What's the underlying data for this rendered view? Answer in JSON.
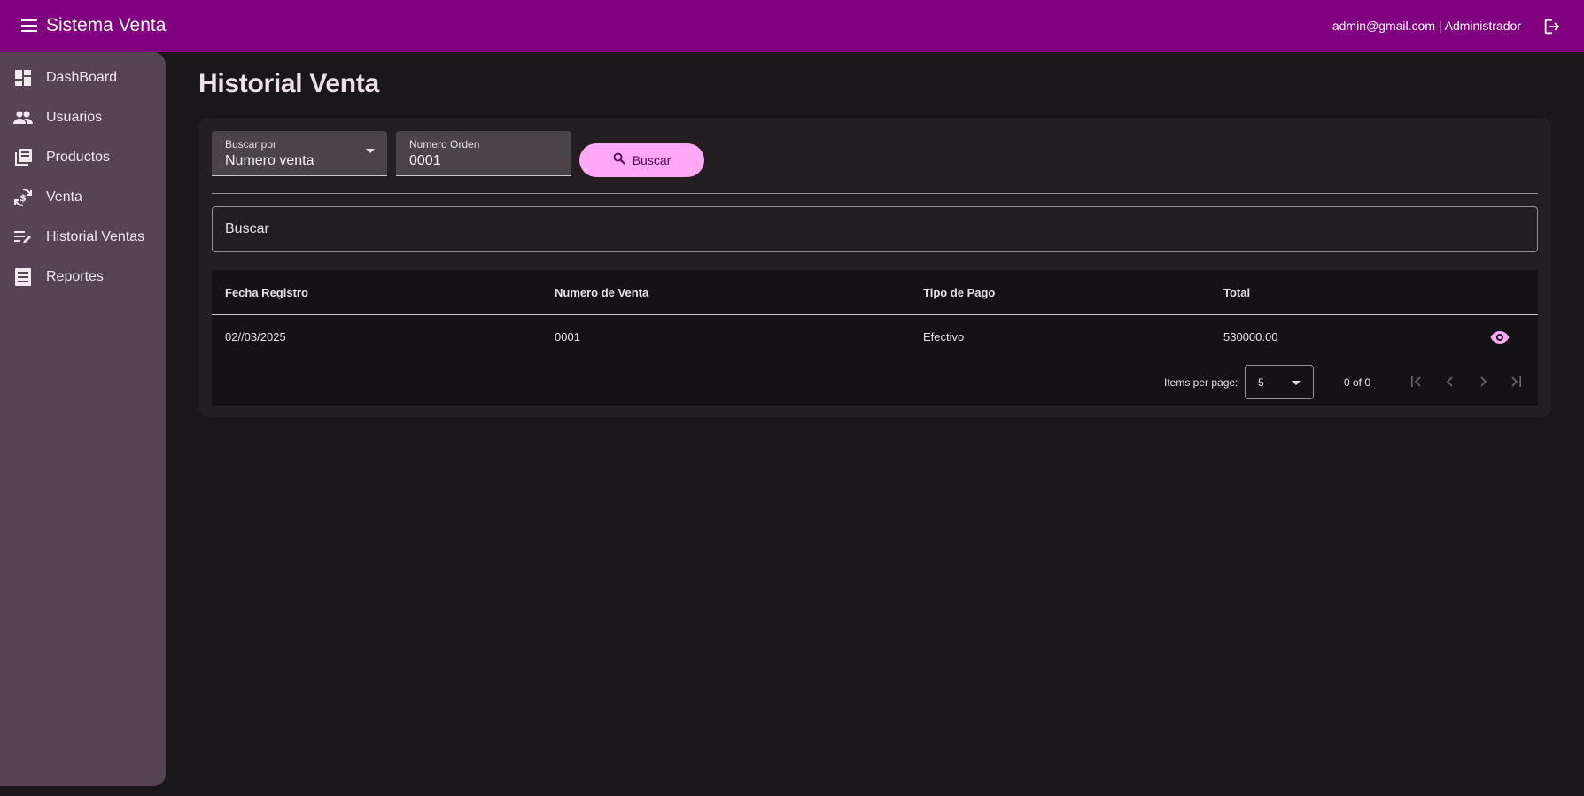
{
  "header": {
    "app_title": "Sistema Venta",
    "user_info": "admin@gmail.com | Administrador",
    "menu_icon": "menu-icon",
    "logout_icon": "logout-icon",
    "background_color": "#800080"
  },
  "sidebar": {
    "items": [
      {
        "label": "DashBoard",
        "icon": "dashboard-icon"
      },
      {
        "label": "Usuarios",
        "icon": "people-icon"
      },
      {
        "label": "Productos",
        "icon": "collections-icon"
      },
      {
        "label": "Venta",
        "icon": "currency-exchange-icon"
      },
      {
        "label": "Historial Ventas",
        "icon": "edit-note-icon"
      },
      {
        "label": "Reportes",
        "icon": "report-icon"
      }
    ]
  },
  "main": {
    "title": "Historial Venta",
    "search_form": {
      "buscar_por_label": "Buscar por",
      "buscar_por_value": "Numero venta",
      "numero_orden_label": "Numero Orden",
      "numero_orden_value": "0001",
      "search_button_label": "Buscar",
      "accent_color": "#ffa8f5"
    },
    "filter": {
      "placeholder": "Buscar"
    },
    "table": {
      "columns": [
        "Fecha Registro",
        "Numero de Venta",
        "Tipo de Pago",
        "Total"
      ],
      "rows": [
        {
          "fecha": "02//03/2025",
          "numero": "0001",
          "tipo_pago": "Efectivo",
          "total": "530000.00",
          "action_icon": "eye-icon"
        }
      ]
    },
    "paginator": {
      "items_per_page_label": "Items per page:",
      "page_size": "5",
      "range_label": "0 of 0"
    }
  }
}
